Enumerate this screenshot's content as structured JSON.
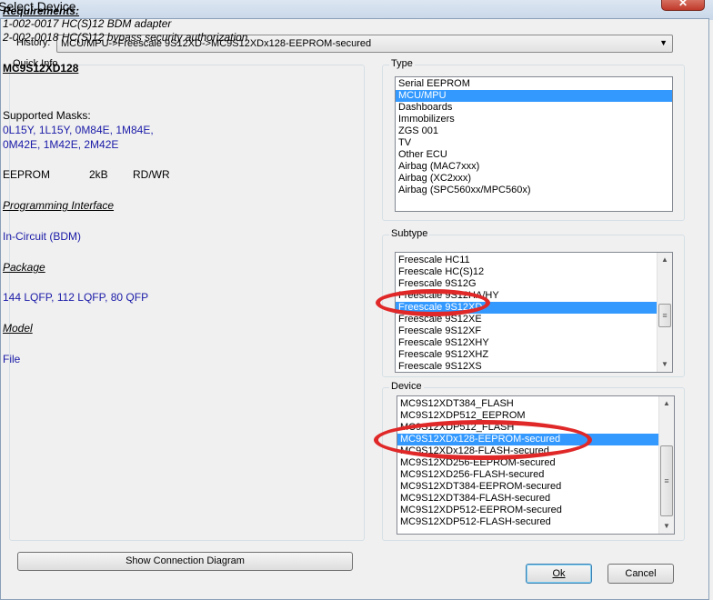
{
  "window": {
    "title": "Select Device",
    "close_icon": "close-icon"
  },
  "history": {
    "label": "History:",
    "value": "MCU/MPU->Freescale 9S12XD->MC9S12XDx128-EEPROM-secured"
  },
  "quick_info": {
    "label": "Quick Info",
    "requirements_heading": "Requirements:",
    "requirements": [
      "1-002-0017  HC(S)12 BDM adapter",
      "2-002-0018  HC(S)12 bypass security authorization"
    ],
    "device_name": "MC9S12XD128",
    "masks_label": "Supported Masks:",
    "masks": [
      "0L15Y, 1L15Y, 0M84E, 1M84E,",
      "0M42E, 1M42E, 2M42E"
    ],
    "memory": {
      "type": "EEPROM",
      "size": "2kB",
      "access": "RD/WR"
    },
    "prog_interface_heading": "Programming Interface",
    "prog_interface": "In-Circuit (BDM)",
    "package_heading": "Package",
    "package": "144 LQFP, 112 LQFP,  80 QFP",
    "model_heading": "Model",
    "model": "File"
  },
  "show_diagram_button": "Show Connection Diagram",
  "type": {
    "label": "Type",
    "selected": 1,
    "items": [
      "Serial EEPROM",
      "MCU/MPU",
      "Dashboards",
      "Immobilizers",
      "ZGS 001",
      "TV",
      "Other ECU",
      "Airbag (MAC7xxx)",
      "Airbag (XC2xxx)",
      "Airbag (SPC560xx/MPC560x)"
    ]
  },
  "subtype": {
    "label": "Subtype",
    "selected": 4,
    "items": [
      "Freescale HC11",
      "Freescale HC(S)12",
      "Freescale 9S12G",
      "Freescale 9S12HA/HY",
      "Freescale 9S12XD",
      "Freescale 9S12XE",
      "Freescale 9S12XF",
      "Freescale 9S12XHY",
      "Freescale 9S12XHZ",
      "Freescale 9S12XS"
    ]
  },
  "device": {
    "label": "Device",
    "selected": 3,
    "items": [
      "MC9S12XDT384_FLASH",
      "MC9S12XDP512_EEPROM",
      "MC9S12XDP512_FLASH",
      "MC9S12XDx128-EEPROM-secured",
      "MC9S12XDx128-FLASH-secured",
      "MC9S12XD256-EEPROM-secured",
      "MC9S12XD256-FLASH-secured",
      "MC9S12XDT384-EEPROM-secured",
      "MC9S12XDT384-FLASH-secured",
      "MC9S12XDP512-EEPROM-secured",
      "MC9S12XDP512-FLASH-secured"
    ]
  },
  "buttons": {
    "ok": "Ok",
    "cancel": "Cancel"
  },
  "colors": {
    "selection": "#3399ff",
    "annotation": "#e02828",
    "info_blue": "#1a1aa8"
  }
}
